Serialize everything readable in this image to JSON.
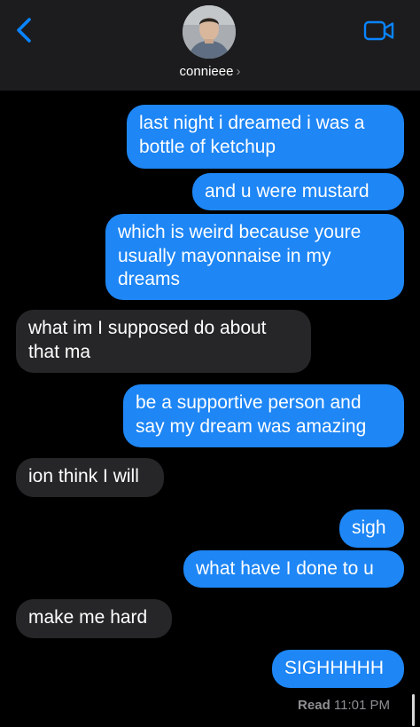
{
  "header": {
    "contact_name": "connieee",
    "contact_chevron": "›",
    "back_icon": "chevron-left-icon",
    "video_icon": "video-camera-icon",
    "accent": "#0a84ff"
  },
  "colors": {
    "sent_bubble": "#1e86f5",
    "received_bubble": "#262628",
    "background": "#000000",
    "header_background": "#1c1c1e"
  },
  "messages": [
    {
      "from": "me",
      "text": "last night i dreamed i was a bottle of ketchup"
    },
    {
      "from": "me",
      "text": "and u were mustard"
    },
    {
      "from": "me",
      "text": "which is weird because youre usually mayonnaise in my dreams"
    },
    {
      "from": "them",
      "text": "what im I supposed do about that ma"
    },
    {
      "from": "me",
      "text": "be a supportive person and say my dream was amazing"
    },
    {
      "from": "them",
      "text": "ion think I will"
    },
    {
      "from": "me",
      "text": "sigh"
    },
    {
      "from": "me",
      "text": "what have I done to u"
    },
    {
      "from": "them",
      "text": "make me hard"
    },
    {
      "from": "me",
      "text": "SIGHHHHH"
    }
  ],
  "read_receipt": {
    "label": "Read",
    "time": "11:01 PM"
  }
}
